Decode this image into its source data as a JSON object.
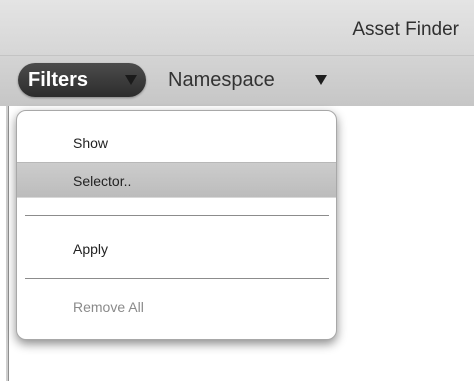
{
  "window": {
    "title": "Asset Finder"
  },
  "toolbar": {
    "filters_label": "Filters",
    "namespace_label": "Namespace"
  },
  "filters_menu": {
    "items": [
      {
        "label": "Show",
        "enabled": true
      },
      {
        "label": "Selector..",
        "enabled": true,
        "highlighted": true
      },
      {
        "label": "Apply",
        "enabled": true
      },
      {
        "label": "Remove All",
        "enabled": false
      }
    ]
  },
  "colors": {
    "title_bar_bg": "#dcdcdc",
    "toolbar_bg": "#cdcdcd",
    "filters_button_bg": "#3a3a3a",
    "highlight_bg": "#c4c4c4",
    "disabled_text": "#8a8a8a"
  },
  "icons": {
    "filters_caret": "chevron-down-icon",
    "namespace_caret": "chevron-down-icon"
  }
}
